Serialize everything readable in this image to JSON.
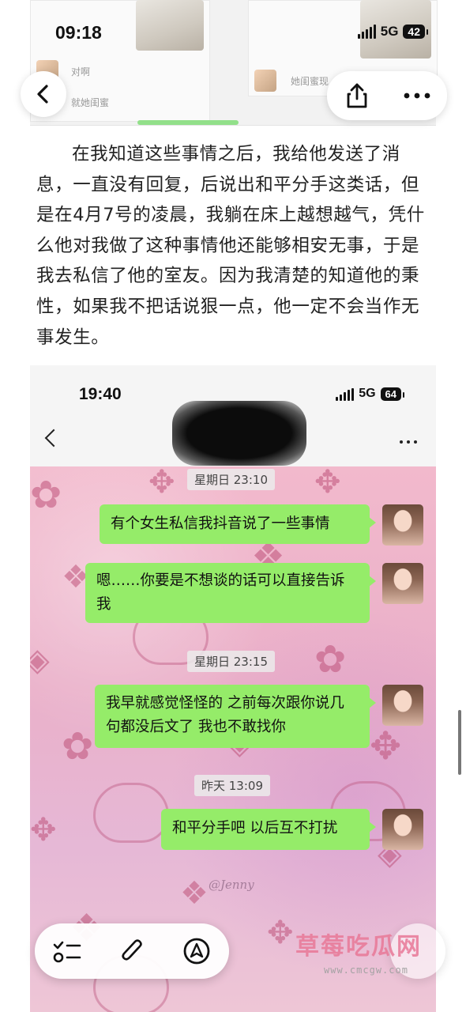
{
  "status_bar": {
    "time": "09:18",
    "network": "5G",
    "battery": "42"
  },
  "top_strip": {
    "reply_text_1": "对啊",
    "reply_text_2": "就她闺蜜",
    "reply_text_3": "她闺蜜现"
  },
  "article": {
    "paragraph": "在我知道这些事情之后，我给他发送了消息，一直没有回复，后说出和平分手这类话，但是在4月7号的凌晨，我躺在床上越想越气，凭什么他对我做了这种事情他还能够相安无事，于是我去私信了他的室友。因为我清楚的知道他的秉性，如果我不把话说狠一点，他一定不会当作无事发生。"
  },
  "chat_screenshot": {
    "status_time": "19:40",
    "network": "5G",
    "battery": "64",
    "messages": [
      {
        "timestamp": "星期日 23:10",
        "text": "有个女生私信我抖音说了一些事情"
      },
      {
        "timestamp": "",
        "text": "嗯……你要是不想谈的话可以直接告诉我"
      },
      {
        "timestamp": "星期日 23:15",
        "text": "我早就感觉怪怪的 之前每次跟你说几句都没后文了 我也不敢找你"
      },
      {
        "timestamp": "昨天 13:09",
        "text": "和平分手吧 以后互不打扰"
      }
    ],
    "wallpaper_signature": "@Jenny"
  },
  "watermark": {
    "site_name": "草莓吃瓜网",
    "site_url": "www.cmcgw.com"
  },
  "icons": [
    "back-arrow-icon",
    "share-icon",
    "more-icon",
    "checklist-icon",
    "paperclip-icon",
    "compass-icon"
  ],
  "colors": {
    "bubble_green": "#95ec69",
    "chat_background_pink": "#eab0c9",
    "watermark_pink": "#e87896"
  }
}
